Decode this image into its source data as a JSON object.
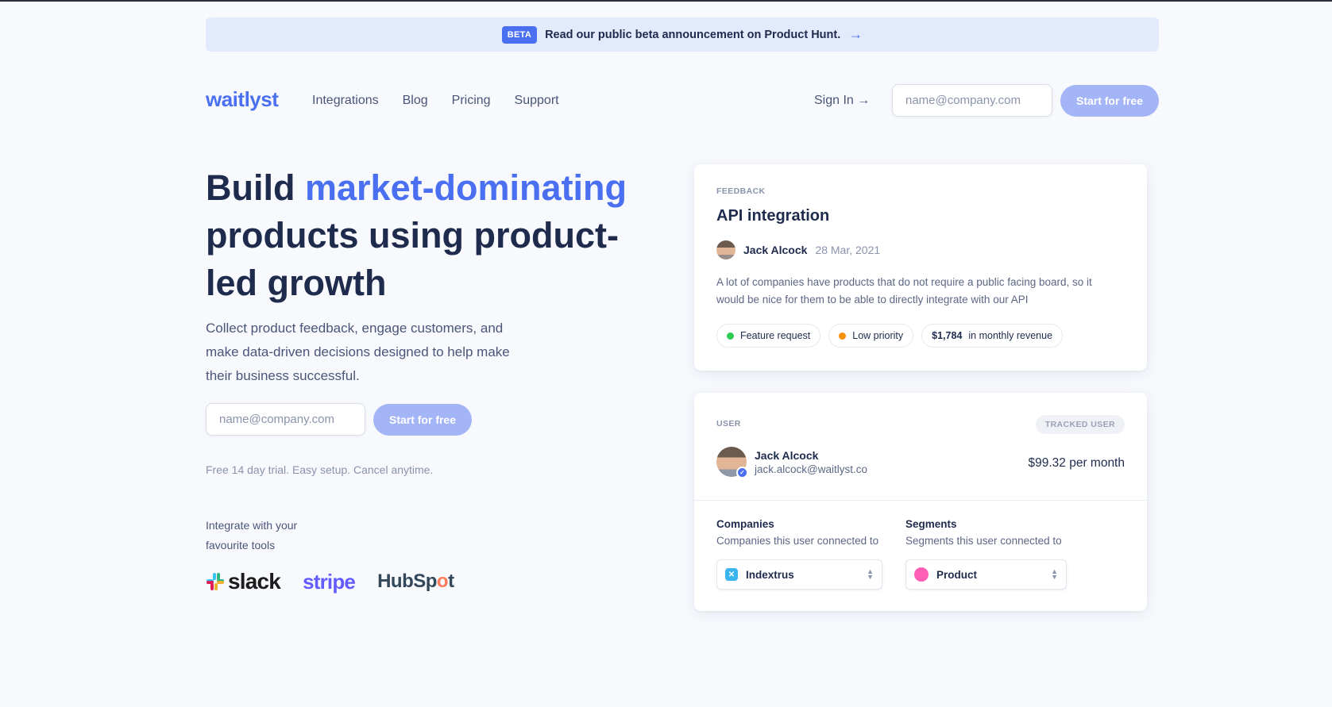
{
  "banner": {
    "badge": "BETA",
    "text": "Read our public beta announcement on Product Hunt.",
    "arrow": "→"
  },
  "nav": {
    "logo": "waitlyst",
    "links": [
      "Integrations",
      "Blog",
      "Pricing",
      "Support"
    ],
    "signin": "Sign In →",
    "email_placeholder": "name@company.com",
    "cta": "Start for free"
  },
  "hero": {
    "title_pre": "Build ",
    "title_accent": "market-dominating",
    "title_post": " products using product-led growth",
    "subtitle": "Collect product feedback, engage customers, and make data-driven decisions designed to help make their business successful.",
    "email_placeholder": "name@company.com",
    "cta": "Start for free",
    "trial": "Free 14 day trial. Easy setup. Cancel anytime.",
    "integrate": "Integrate with your favourite tools",
    "logos": {
      "slack": "slack",
      "stripe": "stripe",
      "hubspot_pre": "HubSp",
      "hubspot_o": "o",
      "hubspot_post": "t"
    }
  },
  "feedback": {
    "label": "FEEDBACK",
    "title": "API integration",
    "author": "Jack Alcock",
    "date": "28 Mar, 2021",
    "body": "A lot of companies have products that do not require a public facing board, so it would be nice for them to be able to directly integrate with our API",
    "tags": [
      {
        "label": "Feature request",
        "color": "#2ecc52"
      },
      {
        "label": "Low priority",
        "color": "#f5900a"
      }
    ],
    "revenue_amount": "$1,784",
    "revenue_label": "in monthly revenue"
  },
  "user": {
    "label": "USER",
    "tracked": "TRACKED USER",
    "name": "Jack Alcock",
    "email": "jack.alcock@waitlyst.co",
    "price": "$99.32 per month",
    "companies_title": "Companies",
    "companies_sub": "Companies this user connected to",
    "companies_value": "Indextrus",
    "segments_title": "Segments",
    "segments_sub": "Segments this user connected to",
    "segments_value": "Product"
  },
  "colors": {
    "accent": "#4a6ff0",
    "button": "#a3b4f7",
    "text": "#1f2b4d"
  }
}
